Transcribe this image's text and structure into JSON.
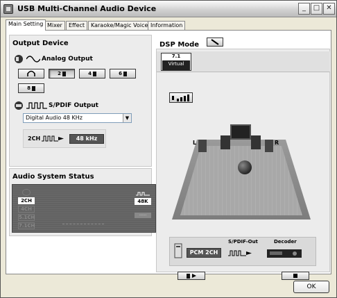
{
  "window": {
    "title": "USB Multi-Channel Audio Device",
    "min_symbol": "_",
    "max_symbol": "□",
    "close_symbol": "✕"
  },
  "tabs": [
    {
      "label": "Main Setting",
      "active": true
    },
    {
      "label": "Mixer",
      "active": false
    },
    {
      "label": "Effect",
      "active": false
    },
    {
      "label": "Karaoke/Magic Voice",
      "active": false
    },
    {
      "label": "Information",
      "active": false
    }
  ],
  "output_device": {
    "heading": "Output Device",
    "analog_label": "Analog Output",
    "speaker_buttons": [
      {
        "label": "",
        "icon": "headphones-icon",
        "selected": false
      },
      {
        "label": "2",
        "icon": "speaker-icon",
        "selected": true
      },
      {
        "label": "4",
        "icon": "speaker-icon",
        "selected": false
      },
      {
        "label": "6",
        "icon": "speaker-icon",
        "selected": false
      },
      {
        "label": "8",
        "icon": "speaker-icon",
        "selected": false
      }
    ],
    "spdif_label": "S/PDIF Output",
    "spdif_select_value": "Digital Audio 48 KHz",
    "channel_label": "2CH",
    "rate_display": "48 kHz"
  },
  "audio_status": {
    "heading": "Audio System Status",
    "channels": [
      "2CH",
      "2CH",
      "4CH",
      "5.1CH",
      "7.1CH"
    ],
    "active_channel": "2CH",
    "rate": "48K",
    "secondary": "-----"
  },
  "dsp": {
    "heading": "DSP Mode",
    "virtual_top": "7.1",
    "virtual_label": "Virtual",
    "speaker_labels": {
      "left": "L",
      "right": "R"
    },
    "spdif_out_label": "S/PDIF-Out",
    "decoder_label": "Decoder",
    "pcm_display": "PCM 2CH"
  },
  "footer": {
    "ok_label": "OK"
  }
}
